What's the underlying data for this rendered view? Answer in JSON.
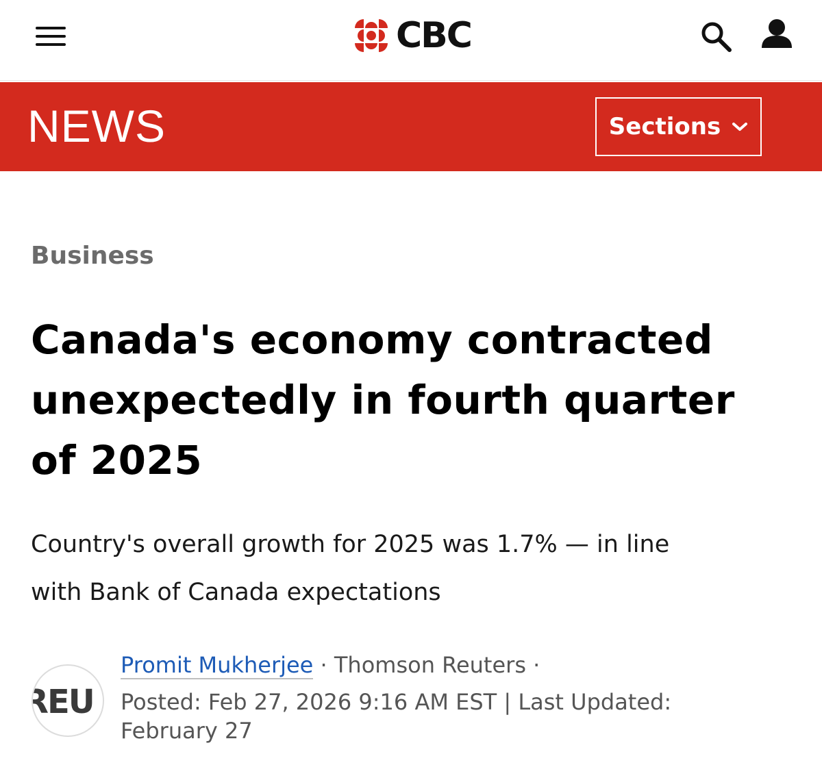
{
  "header": {
    "logo_text": "CBC",
    "icons": {
      "menu": "hamburger-menu-icon",
      "logo": "cbc-gem-icon",
      "search": "search-icon",
      "account": "user-account-icon"
    },
    "colors": {
      "logo_red": "#d32a1e",
      "text": "#111111"
    }
  },
  "news_bar": {
    "title": "NEWS",
    "sections_label": "Sections",
    "sections_icon": "chevron-down-icon",
    "colors": {
      "background": "#d32a1e",
      "text": "#ffffff"
    }
  },
  "article": {
    "category": "Business",
    "headline_lines": [
      "Canada's economy contracted",
      "unexpectedly in fourth quarter",
      "of 2025"
    ],
    "deck_lines": [
      "Country's overall growth for 2025 was 1.7% — in line",
      "with Bank of Canada expectations"
    ],
    "byline": {
      "avatar_text": "REU",
      "author": "Promit Mukherjee",
      "separator": "·",
      "organization": "Thomson Reuters",
      "posted": "Posted: Feb 27, 2026 9:16 AM EST | Last Updated:",
      "updated": "February 27",
      "colors": {
        "author_link": "#1d5bb6",
        "meta_text": "#555555"
      }
    }
  }
}
